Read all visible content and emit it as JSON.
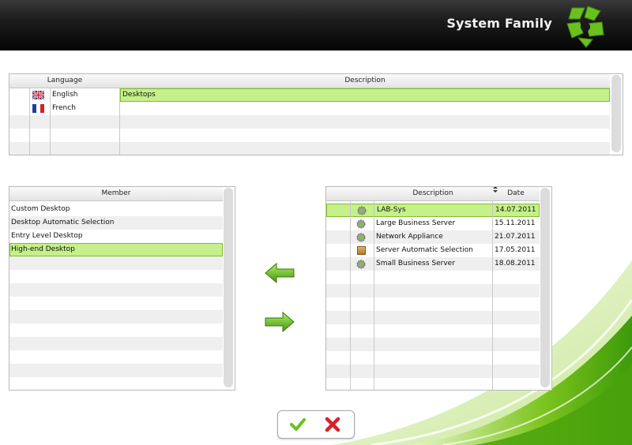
{
  "header": {
    "title": "System Family"
  },
  "language_grid": {
    "columns": [
      "Language",
      "Description"
    ],
    "rows": [
      {
        "language": "English",
        "flag": "uk-flag-icon",
        "description": "Desktops"
      },
      {
        "language": "French",
        "flag": "france-flag-icon",
        "description": ""
      }
    ]
  },
  "member_grid": {
    "columns": [
      "Member"
    ],
    "rows": [
      "Custom Desktop",
      "Desktop Automatic Selection",
      "Entry Level Desktop",
      "High-end Desktop"
    ],
    "selected_index": 3
  },
  "available_grid": {
    "columns": [
      "Description",
      "Date"
    ],
    "rows": [
      {
        "icon": "gear-icon",
        "description": "LAB-Sys",
        "date": "14.07.2011"
      },
      {
        "icon": "gear-icon",
        "description": "Large Business Server",
        "date": "15.11.2011"
      },
      {
        "icon": "gear-icon",
        "description": "Network Appliance",
        "date": "21.07.2011"
      },
      {
        "icon": "package-icon",
        "description": "Server Automatic Selection",
        "date": "17.05.2011"
      },
      {
        "icon": "gear-icon",
        "description": "Small Business Server",
        "date": "18.08.2011"
      }
    ],
    "selected_index": 0
  },
  "colors": {
    "selection": "#c5f08a",
    "accent": "#5fbf1a",
    "header_bg": "#111111"
  }
}
